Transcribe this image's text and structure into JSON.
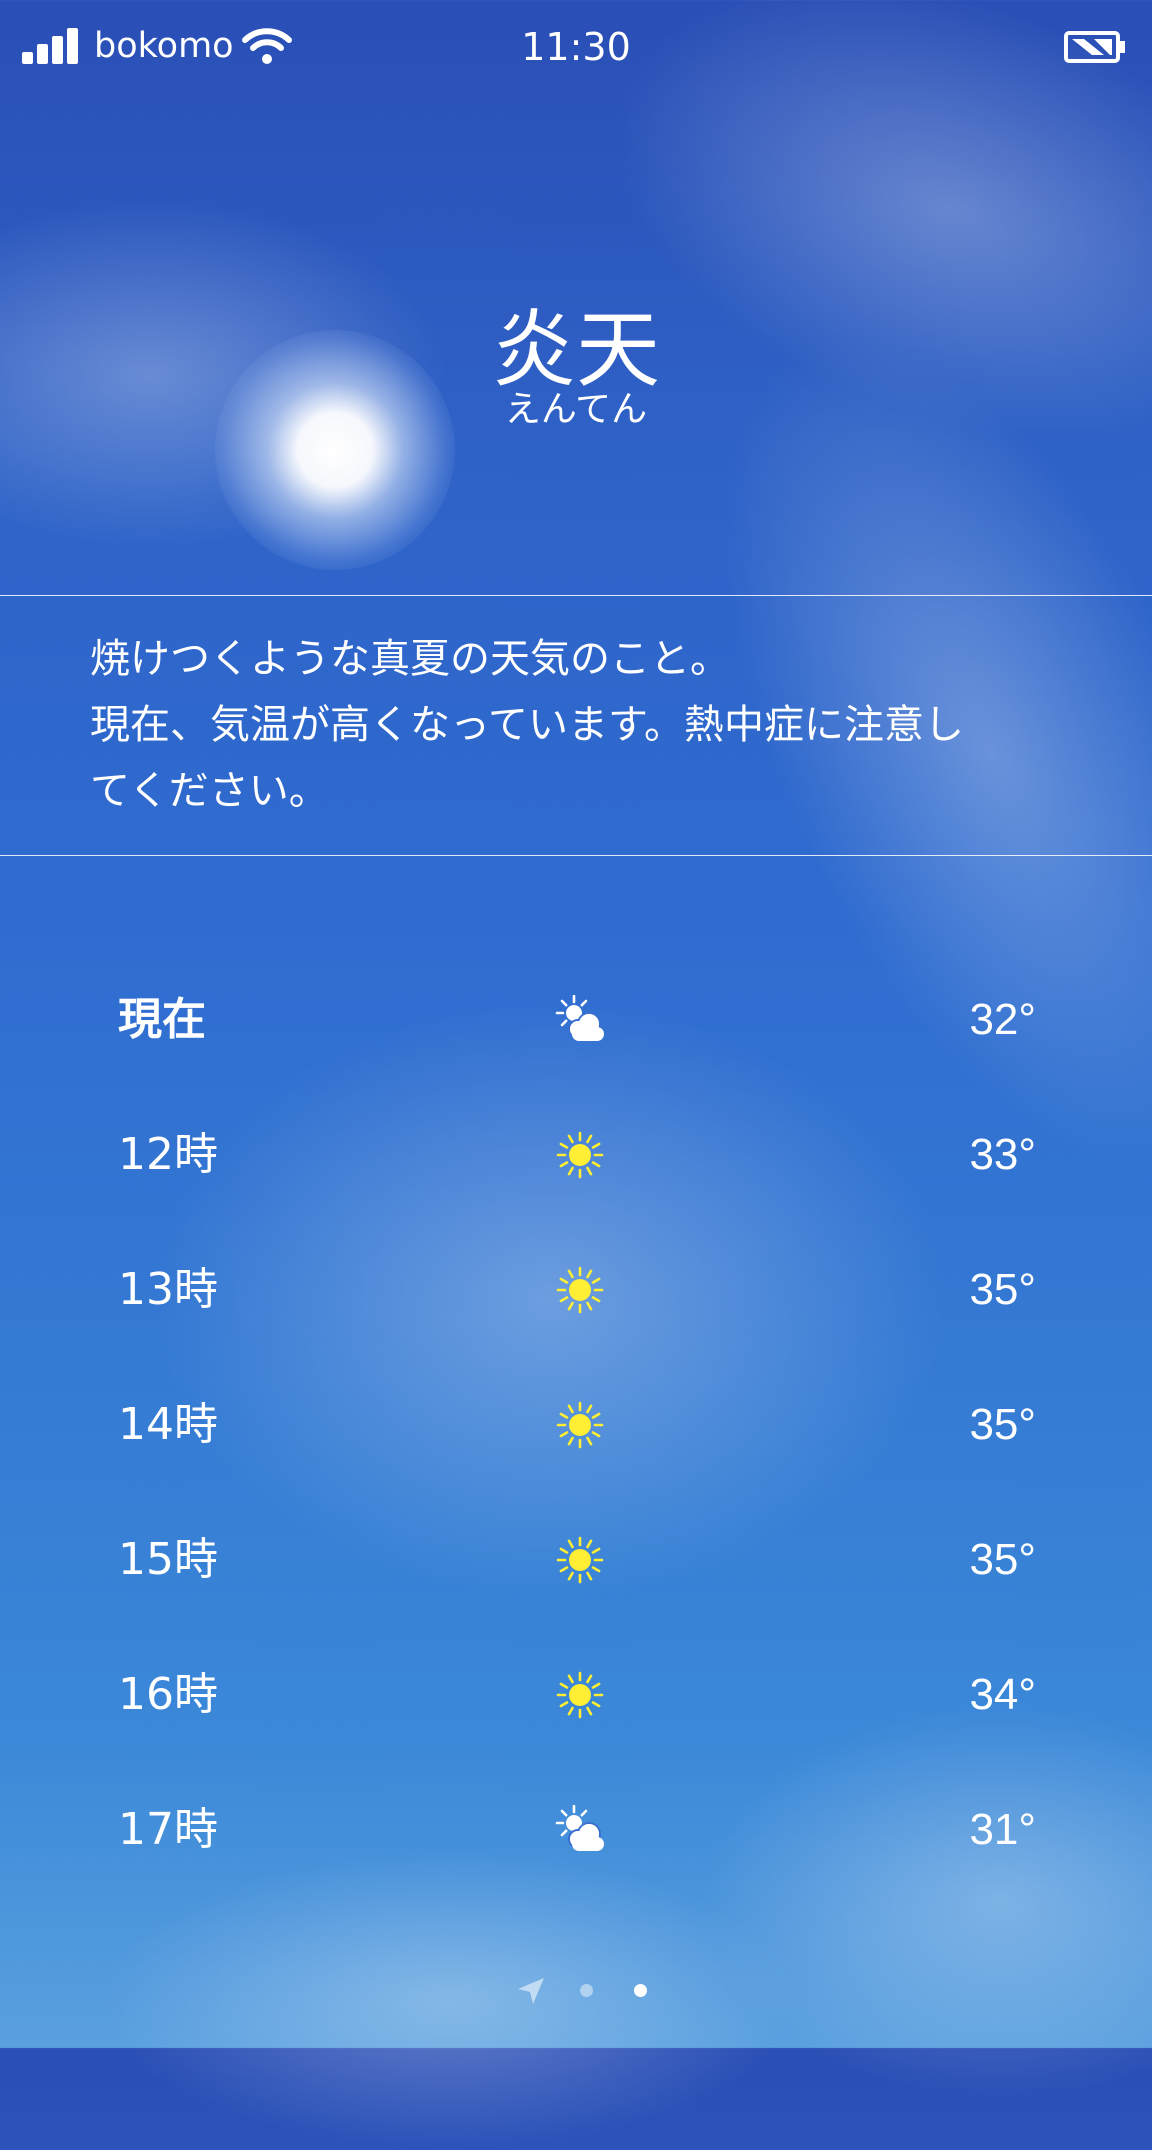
{
  "status_bar": {
    "carrier": "bokomo",
    "time": "11:30"
  },
  "header": {
    "title": "炎天",
    "reading": "えんてん"
  },
  "description": {
    "lines": [
      "焼けつくような真夏の天気のこと。",
      "現在、気温が高くなっています。熱中症に注意し",
      "てください。"
    ]
  },
  "forecast": [
    {
      "time": "現在",
      "icon": "partly-sunny-icon",
      "temp": "32°"
    },
    {
      "time": "12時",
      "icon": "sun-icon",
      "temp": "33°"
    },
    {
      "time": "13時",
      "icon": "sun-icon",
      "temp": "35°"
    },
    {
      "time": "14時",
      "icon": "sun-icon",
      "temp": "35°"
    },
    {
      "time": "15時",
      "icon": "sun-icon",
      "temp": "35°"
    },
    {
      "time": "16時",
      "icon": "sun-icon",
      "temp": "34°"
    },
    {
      "time": "17時",
      "icon": "partly-sunny-icon",
      "temp": "31°"
    }
  ],
  "pager": {
    "page_count": 2,
    "active_page": 2
  },
  "colors": {
    "sky_top": "#2a4fb6",
    "sky_bottom": "#5aa0df",
    "sun_icon": "#ffee33",
    "text": "#ffffff"
  }
}
